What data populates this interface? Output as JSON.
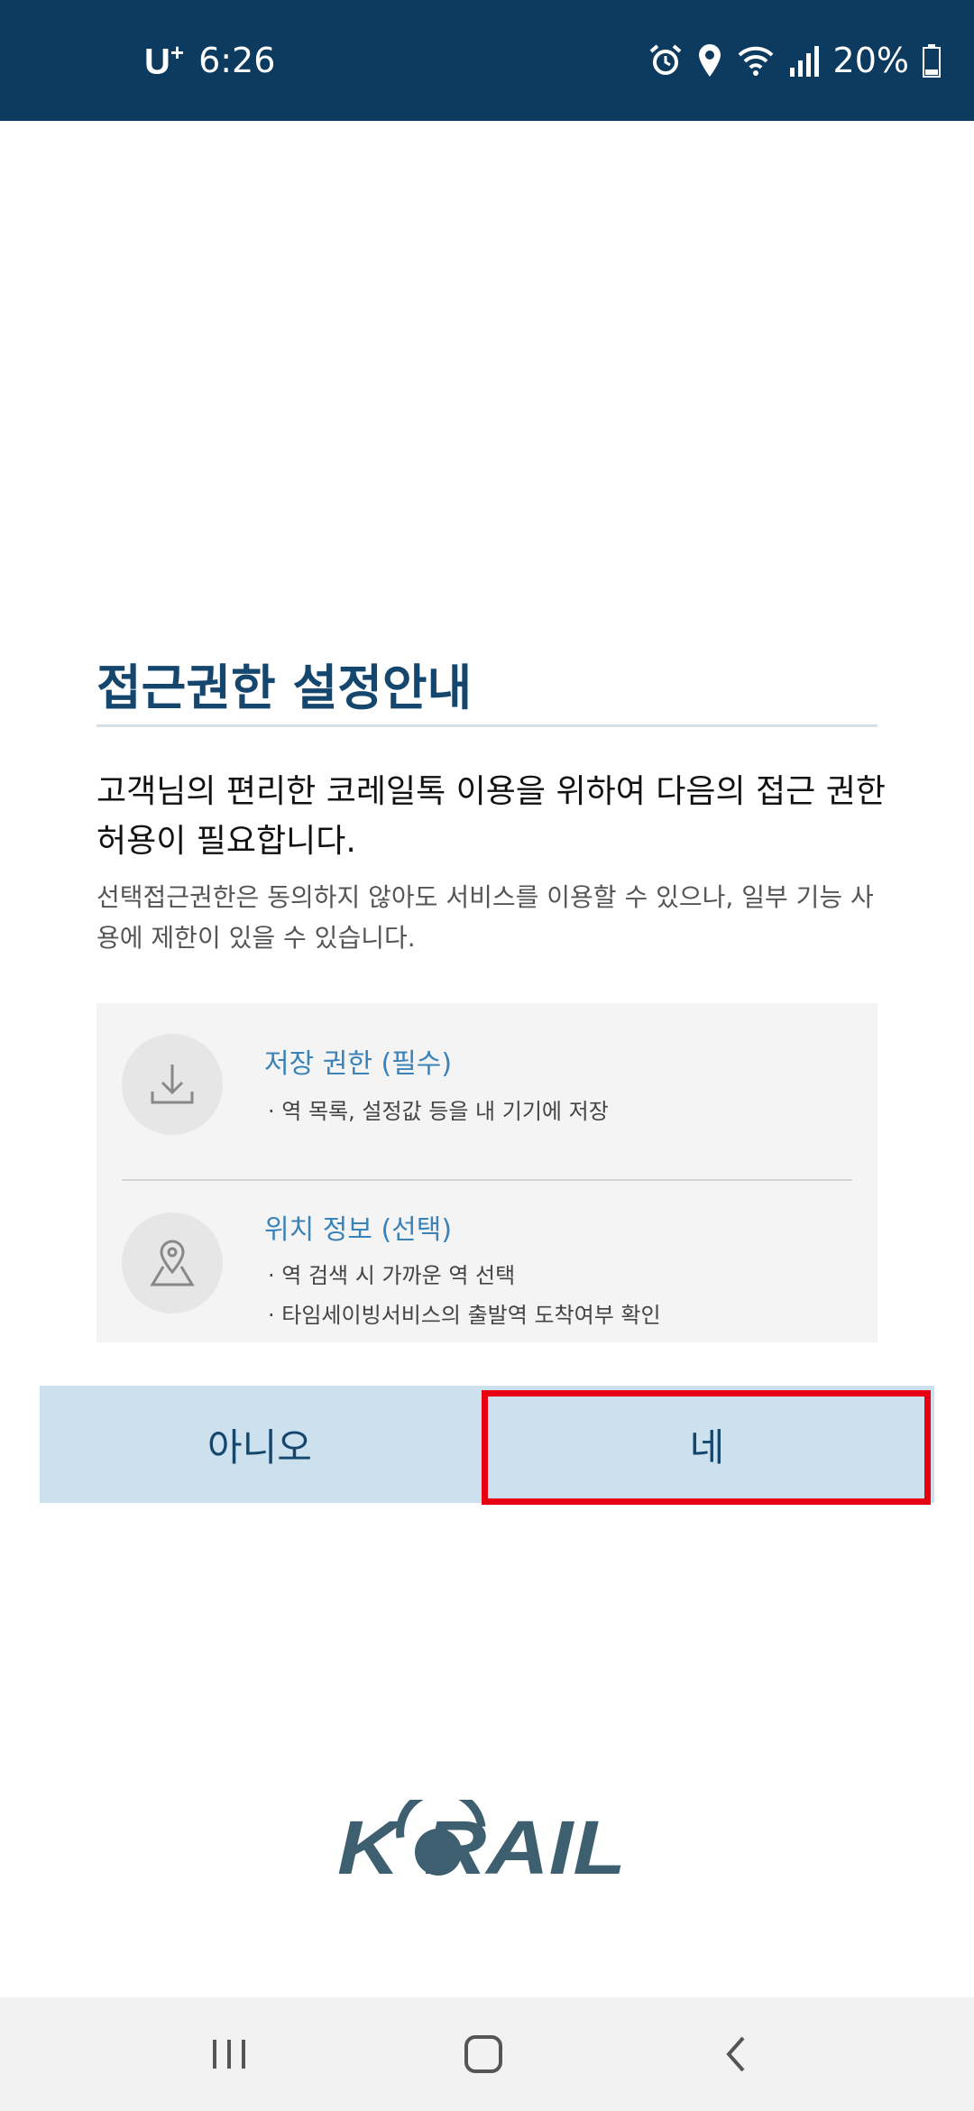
{
  "status_bar": {
    "carrier": "U",
    "carrier_sup": "+",
    "time": "6:26",
    "battery": "20%",
    "icons": [
      "alarm-icon",
      "location-icon",
      "wifi-icon",
      "signal-icon",
      "battery-icon"
    ]
  },
  "dialog": {
    "title": "접근권한 설정안내",
    "description": "고객님의 편리한 코레일톡 이용을 위하여 다음의 접근 권한 허용이 필요합니다.",
    "sub_description": "선택접근권한은 동의하지 않아도 서비스를 이용할 수 있으나, 일부 기능 사용에 제한이 있을 수 있습니다.",
    "permissions": [
      {
        "icon": "download-icon",
        "title": "저장 권한 (필수)",
        "details": [
          "· 역 목록, 설정값 등을 내 기기에 저장"
        ]
      },
      {
        "icon": "map-pin-icon",
        "title": "위치 정보 (선택)",
        "details": [
          "· 역 검색 시 가까운 역 선택",
          "· 타임세이빙서비스의 출발역 도착여부 확인"
        ]
      }
    ],
    "buttons": {
      "no": "아니오",
      "yes": "네"
    }
  },
  "logo": {
    "text": "KORAIL",
    "color": "#3d5f6f"
  },
  "colors": {
    "status_bar": "#0d3a5f",
    "title": "#14466e",
    "perm_title": "#3b82b8",
    "button_bg": "#cce0ee",
    "highlight": "#e60012"
  },
  "nav_bar": {
    "icons": [
      "recent-apps-icon",
      "home-icon",
      "back-icon"
    ]
  }
}
